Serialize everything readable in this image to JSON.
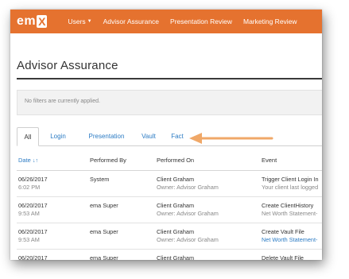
{
  "brand": {
    "em": "em",
    "x": "X"
  },
  "nav": {
    "users": "Users",
    "advisor_assurance": "Advisor Assurance",
    "presentation_review": "Presentation Review",
    "marketing_review": "Marketing Review"
  },
  "page": {
    "title": "Advisor Assurance"
  },
  "filters": {
    "text": "No filters are currently applied."
  },
  "tabs": [
    {
      "label": "All"
    },
    {
      "label": "Login"
    },
    {
      "label": "Presentation"
    },
    {
      "label": "Vault"
    },
    {
      "label": "Fact"
    }
  ],
  "table": {
    "headers": {
      "date": "Date",
      "performed_by": "Performed By",
      "performed_on": "Performed On",
      "event": "Event"
    },
    "rows": [
      {
        "date": "06/26/2017",
        "time": "6:02 PM",
        "by": "System",
        "on": "Client Graham",
        "owner": "Owner: Advisor Graham",
        "event": "Trigger Client Login In",
        "detail": "Your client last logged"
      },
      {
        "date": "06/20/2017",
        "time": "9:53 AM",
        "by": "ema Super",
        "on": "Client Graham",
        "owner": "Owner: Advisor Graham",
        "event": "Create ClientHistory",
        "detail": "Net Worth Statement-"
      },
      {
        "date": "06/20/2017",
        "time": "9:53 AM",
        "by": "ema Super",
        "on": "Client Graham",
        "owner": "Owner: Advisor Graham",
        "event": "Create Vault File",
        "detail": "Net Worth Statement-"
      },
      {
        "date": "06/20/2017",
        "time": "",
        "by": "ema Super",
        "on": "Client Graham",
        "owner": "",
        "event": "Delete Vault File",
        "detail": ""
      }
    ]
  },
  "colors": {
    "nav_bg": "#e5722f",
    "link": "#2b7bc4",
    "arrow": "#f0a868"
  },
  "icons": {
    "users_dropdown": "caret-down-icon",
    "date_sort": "sort-icon",
    "pointer": "arrow-icon"
  }
}
